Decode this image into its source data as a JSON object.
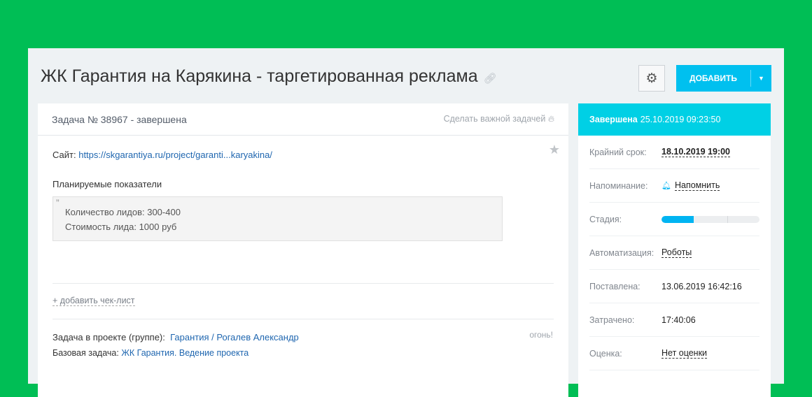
{
  "header": {
    "title": "ЖК Гарантия на Карякина - таргетированная реклама",
    "add_label": "ДОБАВИТЬ"
  },
  "task": {
    "heading": "Задача № 38967 - завершена",
    "make_important": "Сделать важной задачей",
    "site_label": "Сайт:",
    "site_url": "https://skgarantiya.ru/project/garanti...karyakina/",
    "planned": "Планируемые показатели",
    "quote_lines": [
      "Количество лидов: 300-400",
      "Стоимость лида: 1000 руб"
    ],
    "add_checklist": "+ добавить чек-лист",
    "project_label": "Задача в проекте (группе):",
    "project_value": "Гарантия / Рогалев Александр",
    "base_label": "Базовая задача:",
    "base_value": "ЖК Гарантия. Ведение проекта",
    "fire_note": "огонь!"
  },
  "sidebar": {
    "status": "Завершена",
    "status_date": "25.10.2019 09:23:50",
    "deadline_label": "Крайний срок:",
    "deadline": "18.10.2019 19:00",
    "reminder_label": "Напоминание:",
    "reminder": "Напомнить",
    "stage_label": "Стадия:",
    "stage_progress": 0.33,
    "automation_label": "Автоматизация:",
    "automation": "Роботы",
    "created_label": "Поставлена:",
    "created": "13.06.2019 16:42:16",
    "spent_label": "Затрачено:",
    "spent": "17:40:06",
    "rating_label": "Оценка:",
    "rating": "Нет оценки"
  },
  "colors": {
    "background": "#00be55",
    "accent": "#00c0ef",
    "status": "#00d0e5"
  }
}
